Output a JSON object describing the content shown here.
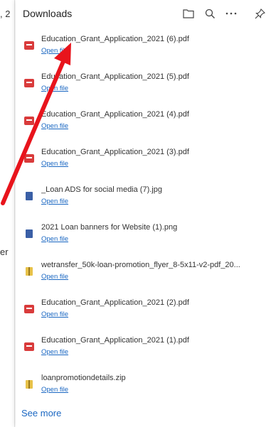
{
  "background_page": {
    "edge_text_top": ", 2",
    "edge_text_mid": "er"
  },
  "downloads": {
    "title": "Downloads",
    "header_icons": [
      "folder-icon",
      "search-icon",
      "more-icon",
      "pin-icon"
    ],
    "open_label": "Open file",
    "see_more": "See more",
    "items": [
      {
        "name": "Education_Grant_Application_2021 (6).pdf",
        "type": "pdf"
      },
      {
        "name": "Education_Grant_Application_2021 (5).pdf",
        "type": "pdf"
      },
      {
        "name": "Education_Grant_Application_2021 (4).pdf",
        "type": "pdf"
      },
      {
        "name": "Education_Grant_Application_2021 (3).pdf",
        "type": "pdf"
      },
      {
        "name": "_Loan ADS for social media (7).jpg",
        "type": "img"
      },
      {
        "name": "2021 Loan banners for Website (1).png",
        "type": "img"
      },
      {
        "name": "wetransfer_50k-loan-promotion_flyer_8-5x11-v2-pdf_20...",
        "type": "zip"
      },
      {
        "name": "Education_Grant_Application_2021 (2).pdf",
        "type": "pdf"
      },
      {
        "name": "Education_Grant_Application_2021 (1).pdf",
        "type": "pdf"
      },
      {
        "name": "loanpromotiondetails.zip",
        "type": "zip"
      }
    ]
  },
  "annotation": {
    "color": "#e8141c",
    "icon": "red-arrow"
  }
}
